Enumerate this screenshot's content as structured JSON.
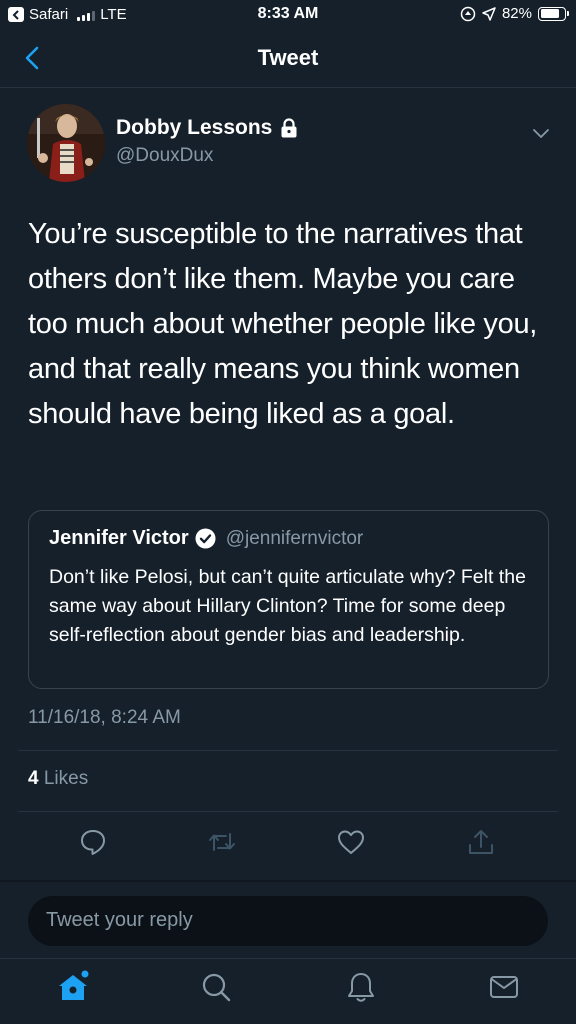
{
  "status_bar": {
    "back_app": "Safari",
    "carrier": "LTE",
    "time": "8:33 AM",
    "battery": "82%",
    "battery_level": 0.82,
    "icons": [
      "back-app-icon",
      "signal-icon",
      "location-lock-icon",
      "location-arrow-icon",
      "battery-icon"
    ]
  },
  "nav": {
    "title": "Tweet",
    "back_icon": "chevron-left-icon"
  },
  "tweet": {
    "author_name": "Dobby Lessons",
    "author_handle": "@DouxDux",
    "protected_icon": "lock-icon",
    "menu_icon": "chevron-down-icon",
    "text": "You’re susceptible to the narratives that others don’t like them. Maybe you care too much about whether people like you, and that really means you think women should have being liked as a goal.",
    "timestamp": "11/16/18, 8:24 AM",
    "likes_count": "4",
    "likes_label": "Likes"
  },
  "quoted_tweet": {
    "name": "Jennifer Victor",
    "handle": "@jennifernvictor",
    "verified_icon": "verified-badge-icon",
    "text": "Don’t like Pelosi, but can’t quite articulate why? Felt the same way about Hillary Clinton? Time for some deep self-reflection about gender bias and leadership."
  },
  "actions": [
    "reply-icon",
    "retweet-icon",
    "like-icon",
    "share-icon"
  ],
  "reply_box": {
    "placeholder": "Tweet your reply"
  },
  "tab_bar": {
    "tabs": [
      "home-icon",
      "search-icon",
      "notifications-icon",
      "messages-icon"
    ],
    "active": "home-icon"
  },
  "colors": {
    "background": "#15202b",
    "accent": "#1da1f2",
    "secondary_text": "#8899a6",
    "border": "#38444d"
  }
}
